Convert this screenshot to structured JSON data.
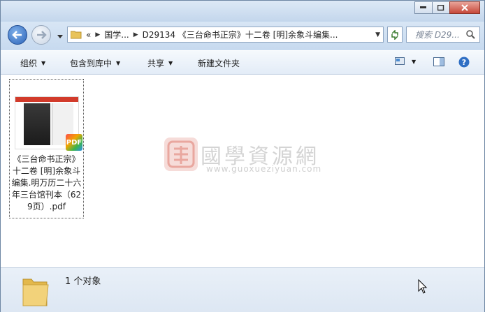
{
  "address": {
    "overflow_glyph": "«",
    "crumbs": [
      "国学...",
      "D29134 《三台命书正宗》十二卷 [明]余象斗编集..."
    ]
  },
  "search": {
    "placeholder": "搜索 D29..."
  },
  "toolbar": {
    "organize": "组织",
    "include_in_library": "包含到库中",
    "share": "共享",
    "new_folder": "新建文件夹"
  },
  "file": {
    "name": "《三台命书正宗》十二卷 [明]余象斗编集.明万历二十六年三台馆刊本（629页）.pdf",
    "thumb_label": "PDF",
    "badge": "PDF"
  },
  "watermark": {
    "text": "國學資源網",
    "url": "www.guoxueziyuan.com"
  },
  "status": {
    "text": "1 个对象"
  },
  "colors": {
    "accent": "#2c64b8",
    "close": "#c7483a",
    "pdf_red": "#d23b2b"
  }
}
